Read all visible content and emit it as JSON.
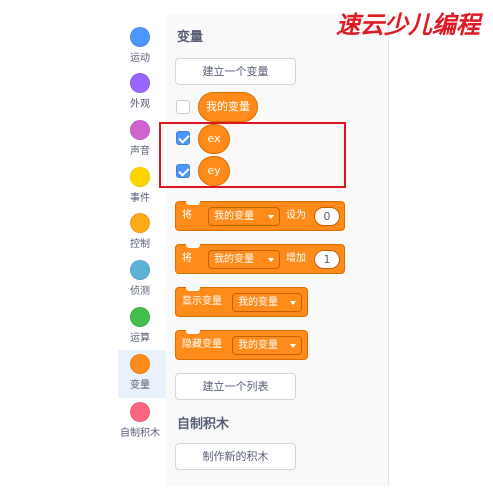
{
  "categories": [
    {
      "label": "运动",
      "color": "#4c97ff",
      "icon": "motion-icon"
    },
    {
      "label": "外观",
      "color": "#9966ff",
      "icon": "looks-icon"
    },
    {
      "label": "声音",
      "color": "#cf63cf",
      "icon": "sound-icon"
    },
    {
      "label": "事件",
      "color": "#ffd500",
      "icon": "events-icon"
    },
    {
      "label": "控制",
      "color": "#ffab19",
      "icon": "control-icon"
    },
    {
      "label": "侦测",
      "color": "#5cb1d6",
      "icon": "sensing-icon"
    },
    {
      "label": "运算",
      "color": "#40bf4a",
      "icon": "operators-icon"
    },
    {
      "label": "变量",
      "color": "#ff8c1a",
      "icon": "variables-icon",
      "selected": true
    },
    {
      "label": "自制积木",
      "color": "#ff6680",
      "icon": "my-blocks-icon"
    }
  ],
  "variables_section": {
    "title": "变量",
    "make_variable_button": "建立一个变量",
    "variables": [
      {
        "name": "我的变量",
        "checked": false
      },
      {
        "name": "ex",
        "checked": true
      },
      {
        "name": "ey",
        "checked": true
      }
    ]
  },
  "blocks": {
    "set": {
      "prefix": "将",
      "variable": "我的变量",
      "suffix": "设为",
      "value": "0"
    },
    "change": {
      "prefix": "将",
      "variable": "我的变量",
      "suffix": "增加",
      "value": "1"
    },
    "show": {
      "label": "显示变量",
      "variable": "我的变量"
    },
    "hide": {
      "label": "隐藏变量",
      "variable": "我的变量"
    }
  },
  "make_list_button": "建立一个列表",
  "my_blocks_section": {
    "title": "自制积木",
    "make_block_button": "制作新的积木"
  },
  "watermark": {
    "text": "速云少儿编程"
  },
  "colors": {
    "variables": "#ff8c1a",
    "highlight": "#e0141f",
    "checkbox": "#4c97ff"
  }
}
